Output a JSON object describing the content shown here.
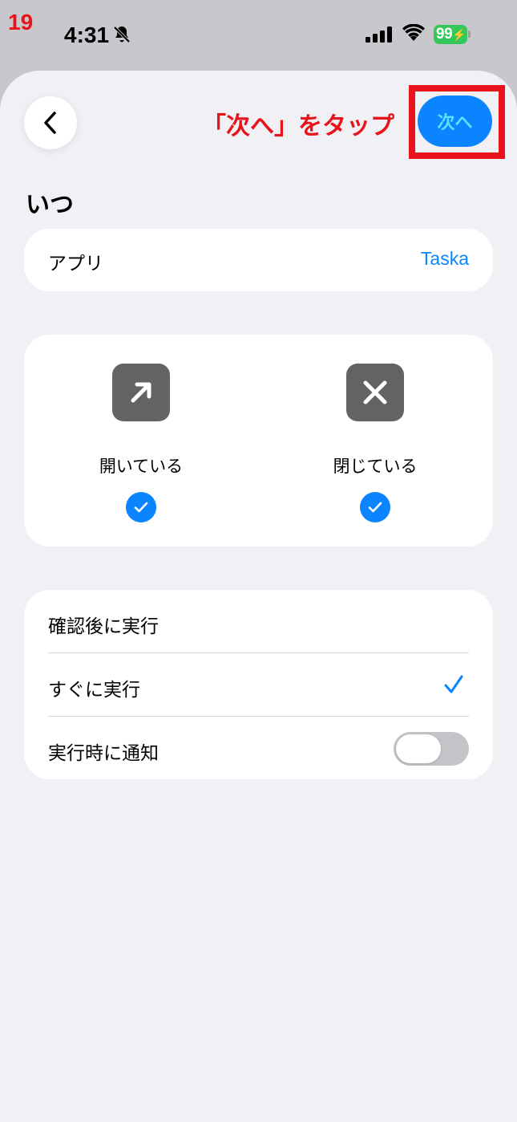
{
  "step_number": "19",
  "status_bar": {
    "time": "4:31",
    "battery": "99"
  },
  "header": {
    "instruction": "「次へ」をタップ",
    "next_label": "次へ"
  },
  "section_title": "いつ",
  "app_row": {
    "label": "アプリ",
    "value": "Taska"
  },
  "states": [
    {
      "label": "開いている",
      "icon": "arrow-up-right-icon",
      "checked": true
    },
    {
      "label": "閉じている",
      "icon": "xmark-icon",
      "checked": true
    }
  ],
  "run_options": {
    "confirm_label": "確認後に実行",
    "immediate_label": "すぐに実行",
    "immediate_selected": true,
    "notify_label": "実行時に通知",
    "notify_on": false
  },
  "colors": {
    "accent": "#0a84ff",
    "annotation_red": "#e8141b",
    "battery_green": "#34c759"
  }
}
